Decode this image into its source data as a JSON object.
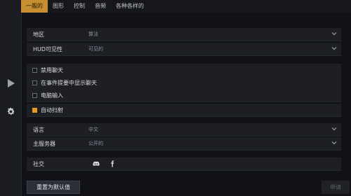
{
  "tabs": [
    {
      "label": "一般的",
      "active": true
    },
    {
      "label": "图形",
      "active": false
    },
    {
      "label": "控制",
      "active": false
    },
    {
      "label": "音频",
      "active": false
    },
    {
      "label": "各种各样的",
      "active": false
    }
  ],
  "sidebar": {
    "play_icon": "play-icon",
    "settings_icon": "gear-icon"
  },
  "settings": {
    "region": {
      "label": "地区",
      "value": "算法"
    },
    "hud_visibility": {
      "label": "HUD可见性",
      "value": "可见的"
    },
    "disable_chat": {
      "label": "禁用聊天",
      "checked": false
    },
    "show_chat_in_event_summary": {
      "label": "在事件提要中显示聊天",
      "checked": false
    },
    "pc_input": {
      "label": "电脑输入",
      "checked": false
    },
    "auto_shoot": {
      "label": "自动扫射",
      "checked": true
    },
    "language": {
      "label": "语言",
      "value": "中文"
    },
    "main_server": {
      "label": "主服务器",
      "value": "公开的"
    },
    "social": {
      "label": "社交",
      "icons": [
        "discord-icon",
        "facebook-icon"
      ]
    }
  },
  "buttons": {
    "reset": "重置为默认值",
    "apply": "申请"
  },
  "colors": {
    "accent": "#c68f32",
    "checkbox_checked": "#e39a2d",
    "background": "#101217",
    "row_background": "#1d1f25"
  }
}
